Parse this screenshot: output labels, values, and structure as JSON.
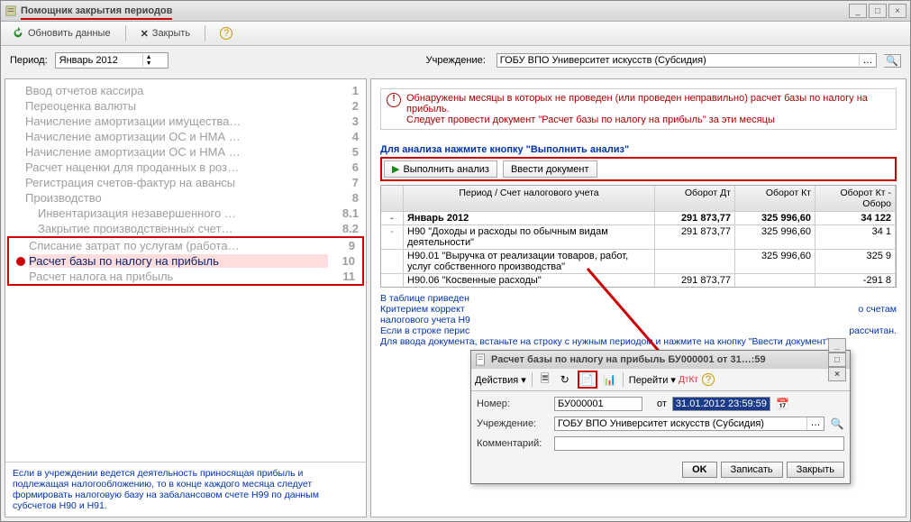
{
  "window": {
    "title": "Помощник закрытия периодов"
  },
  "toolbar": {
    "refresh": "Обновить данные",
    "close": "Закрыть"
  },
  "period": {
    "label": "Период:",
    "value": "Январь 2012"
  },
  "institution": {
    "label": "Учреждение:",
    "value": "ГОБУ ВПО Университет искусств (Субсидия)"
  },
  "tasks": [
    {
      "name": "Ввод отчетов кассира",
      "num": "1"
    },
    {
      "name": "Переоценка валюты",
      "num": "2"
    },
    {
      "name": "Начисление амортизации имущества…",
      "num": "3"
    },
    {
      "name": "Начисление амортизации ОС и НМА …",
      "num": "4"
    },
    {
      "name": "Начисление амортизации ОС и НМА …",
      "num": "5"
    },
    {
      "name": "Расчет наценки для проданных в роз…",
      "num": "6"
    },
    {
      "name": "Регистрация счетов-фактур на авансы",
      "num": "7"
    },
    {
      "name": "Производство",
      "num": "8"
    },
    {
      "name": "Инвентаризация незавершенного …",
      "num": "8.1"
    },
    {
      "name": "Закрытие производственных счет…",
      "num": "8.2"
    },
    {
      "name": "Списание затрат по услугам (работа…",
      "num": "9"
    },
    {
      "name": "Расчет базы по налогу на прибыль",
      "num": "10",
      "selected": true,
      "marker": "red"
    },
    {
      "name": "Расчет налога на прибыль",
      "num": "11"
    }
  ],
  "left_info": "Если в учреждении ведется деятельность приносящая прибыль и подлежащая налогообложению, то в конце каждого месяца следует формировать налоговую базу на забалансовом счете Н99 по данным субсчетов Н90 и Н91.",
  "warning": {
    "line1": "Обнаружены месяцы в которых не проведен (или проведен неправильно) расчет базы по налогу на прибыль.",
    "line2": "Следует провести документ \"Расчет базы по налогу на прибыль\" за эти месяцы"
  },
  "analysis_hint": "Для анализа нажмите кнопку \"Выполнить анализ\"",
  "buttons": {
    "analyze": "Выполнить анализ",
    "enter_doc": "Ввести документ"
  },
  "grid": {
    "headers": {
      "period": "Период / Счет налогового учета",
      "dt": "Оборот Дт",
      "kt": "Оборот Кт",
      "diff": "Оборот Кт - Оборо"
    },
    "rows": [
      {
        "level": 0,
        "bold": true,
        "expand": "-",
        "name": "Январь 2012",
        "dt": "291 873,77",
        "kt": "325 996,60",
        "diff": "34 122"
      },
      {
        "level": 1,
        "expand": "-",
        "name": "Н90 \"Доходы и расходы по обычным видам деятельности\"",
        "dt": "291 873,77",
        "kt": "325 996,60",
        "diff": "34 1"
      },
      {
        "level": 2,
        "name": "Н90.01 \"Выручка от реализации товаров, работ, услуг собственного производства\"",
        "dt": "",
        "kt": "325 996,60",
        "diff": "325 9"
      },
      {
        "level": 2,
        "name": "Н90.06 \"Косвенные расходы\"",
        "dt": "291 873,77",
        "kt": "",
        "diff": "-291 8"
      }
    ]
  },
  "right_info": {
    "line1": "В таблице приведен",
    "line2": "Критерием коррект",
    "line3": "налогового учета Н9",
    "line4": "Если в строке перис",
    "line5": "Для ввода документа, встаньте на строку с нужным периодом и нажмите на кнопку \"Ввести документ\".",
    "right1": "о счетам",
    "right2": "рассчитан."
  },
  "doc": {
    "title": "Расчет базы по налогу на прибыль БУ000001 от 31…:59",
    "actions_label": "Действия",
    "goto_label": "Перейти",
    "number_label": "Номер:",
    "number_value": "БУ000001",
    "from_label": "от",
    "date_value": "31.01.2012 23:59:59",
    "inst_label": "Учреждение:",
    "inst_value": "ГОБУ ВПО Университет искусств (Субсидия)",
    "comment_label": "Комментарий:",
    "comment_value": "",
    "ok": "OK",
    "save": "Записать",
    "close": "Закрыть"
  }
}
